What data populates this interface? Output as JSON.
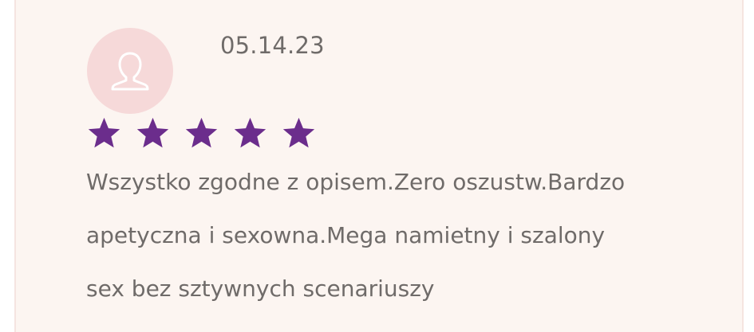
{
  "review": {
    "date": "05.14.23",
    "rating": 5,
    "rating_max": 5,
    "text_lines": [
      "Wszystko zgodne z opisem.Zero oszustw.Bardzo",
      "apetyczna i sexowna.Mega namietny i szalony",
      "sex bez sztywnych scenariuszy"
    ]
  },
  "colors": {
    "card_background": "#fcf5f1",
    "avatar_background": "#f6d9d9",
    "star": "#6b2d8c",
    "text": "#6f6b69"
  },
  "icons": {
    "avatar": "user-icon",
    "rating": "star-icon"
  }
}
